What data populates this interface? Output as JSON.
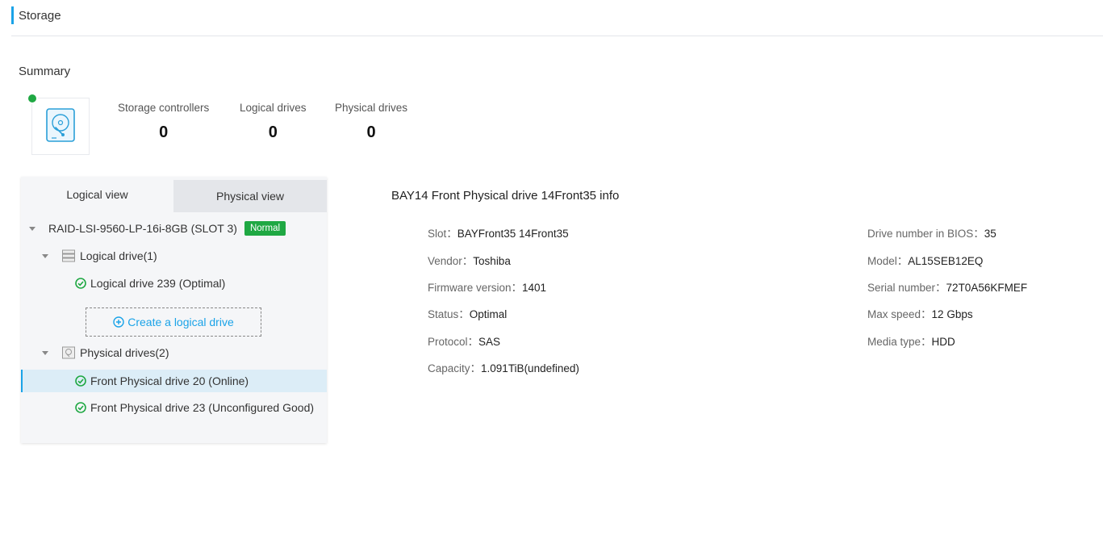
{
  "header": {
    "title": "Storage"
  },
  "summary": {
    "title": "Summary",
    "stats": [
      {
        "label": "Storage controllers",
        "value": "0"
      },
      {
        "label": "Logical drives",
        "value": "0"
      },
      {
        "label": "Physical drives",
        "value": "0"
      }
    ]
  },
  "tabs": {
    "logical": "Logical view",
    "physical": "Physical view"
  },
  "tree": {
    "controller": {
      "label": "RAID-LSI-9560-LP-16i-8GB (SLOT 3)",
      "badge": "Normal"
    },
    "logical_group": {
      "label": "Logical drive(1)"
    },
    "logical_items": [
      "Logical drive 239 (Optimal)"
    ],
    "create_label": "Create a logical drive",
    "physical_group": {
      "label": "Physical drives(2)"
    },
    "physical_items": [
      "Front Physical drive 20 (Online)",
      "Front Physical drive 23 (Unconfigured Good)"
    ]
  },
  "info": {
    "title": "BAY14 Front Physical drive 14Front35 info",
    "left": [
      {
        "key": "Slot：",
        "value": "BAYFront35 14Front35"
      },
      {
        "key": "Vendor：",
        "value": "Toshiba"
      },
      {
        "key": "Firmware version：",
        "value": "1401"
      },
      {
        "key": "Status：",
        "value": "Optimal"
      },
      {
        "key": "Protocol：",
        "value": "SAS"
      },
      {
        "key": "Capacity：",
        "value": "1.091TiB(undefined)"
      }
    ],
    "right": [
      {
        "key": "Drive number in BIOS：",
        "value": "35"
      },
      {
        "key": "Model：",
        "value": "AL15SEB12EQ"
      },
      {
        "key": "Serial number：",
        "value": "72T0A56KFMEF"
      },
      {
        "key": "Max speed：",
        "value": "12 Gbps"
      },
      {
        "key": "Media type：",
        "value": "HDD"
      }
    ]
  },
  "colors": {
    "accent": "#1aa3e8",
    "ok": "#1fa843",
    "selected_bg": "#dcedf7"
  },
  "icons": [
    "hard-drive-icon",
    "check-circle-icon",
    "plus-circle-icon",
    "server-icon",
    "disk-icon",
    "caret-down-icon"
  ]
}
